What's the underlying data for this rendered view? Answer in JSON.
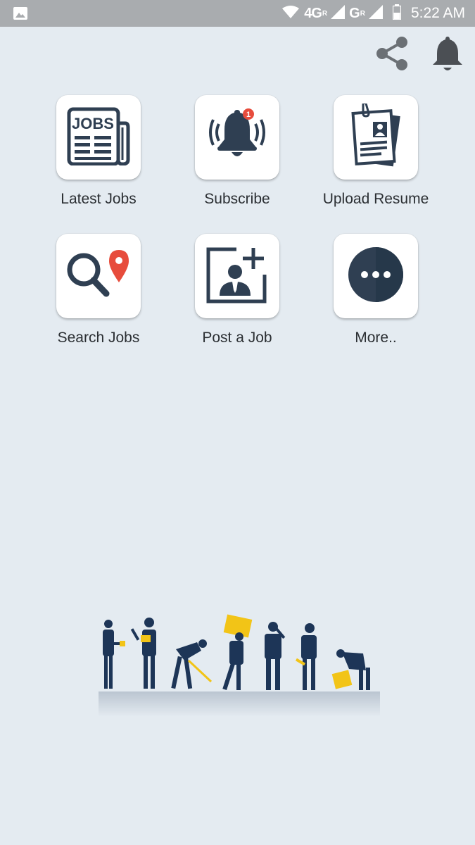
{
  "statusbar": {
    "network1": "4G",
    "network1_sup": "R",
    "network2": "G",
    "network2_sup": "R",
    "time": "5:22 AM"
  },
  "header": {
    "share_icon": "share-icon",
    "notification_icon": "bell-icon"
  },
  "menu": [
    {
      "label": "Latest Jobs",
      "icon": "newspaper-jobs-icon"
    },
    {
      "label": "Subscribe",
      "icon": "ringing-bell-icon",
      "badge": "1"
    },
    {
      "label": "Upload Resume",
      "icon": "resume-clipboard-icon"
    },
    {
      "label": "Search Jobs",
      "icon": "search-location-icon"
    },
    {
      "label": "Post a Job",
      "icon": "add-person-icon"
    },
    {
      "label": "More..",
      "icon": "more-dots-icon"
    }
  ],
  "colors": {
    "background": "#e4ebf1",
    "statusbar": "#a9acaf",
    "icon_dark": "#2f3f52",
    "accent_red": "#e74c3c",
    "accent_yellow": "#f2c417",
    "worker_navy": "#1d3557"
  }
}
